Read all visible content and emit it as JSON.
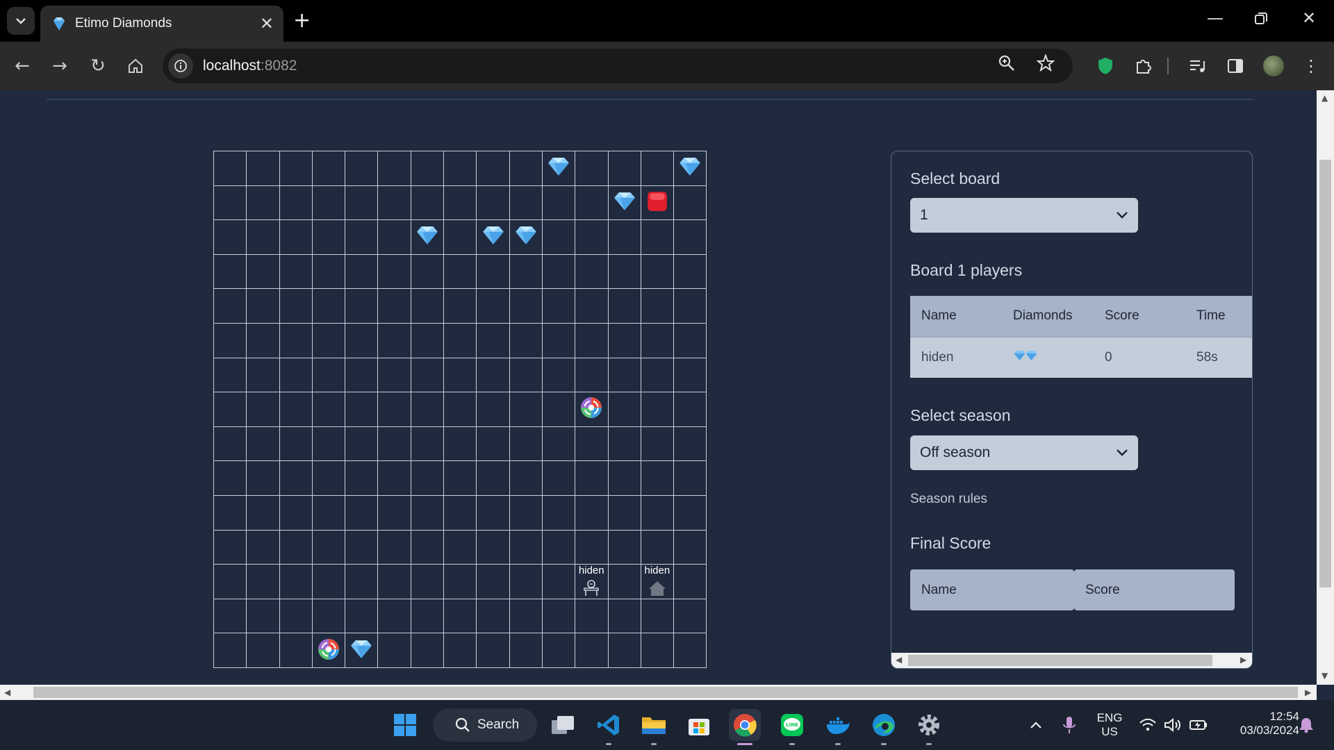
{
  "browser": {
    "tab_title": "Etimo Diamonds",
    "url_host": "localhost",
    "url_port": ":8082"
  },
  "board": {
    "rows": 15,
    "cols": 15,
    "objects": [
      {
        "type": "diamond",
        "row": 0,
        "col": 10
      },
      {
        "type": "diamond",
        "row": 0,
        "col": 14
      },
      {
        "type": "diamond",
        "row": 1,
        "col": 12
      },
      {
        "type": "red-button",
        "row": 1,
        "col": 13
      },
      {
        "type": "diamond",
        "row": 2,
        "col": 6
      },
      {
        "type": "diamond",
        "row": 2,
        "col": 8
      },
      {
        "type": "diamond",
        "row": 2,
        "col": 9
      },
      {
        "type": "teleporter",
        "row": 7,
        "col": 11
      },
      {
        "type": "bot",
        "row": 12,
        "col": 11,
        "label": "hiden"
      },
      {
        "type": "base",
        "row": 12,
        "col": 13,
        "label": "hiden"
      },
      {
        "type": "teleporter",
        "row": 14,
        "col": 3
      },
      {
        "type": "diamond",
        "row": 14,
        "col": 4
      }
    ]
  },
  "panel": {
    "select_board_heading": "Select board",
    "board_value": "1",
    "players_heading": "Board 1 players",
    "players_table": {
      "headers": [
        "Name",
        "Diamonds",
        "Score",
        "Time"
      ],
      "rows": [
        {
          "name": "hiden",
          "diamonds": 2,
          "score": "0",
          "time": "58s"
        }
      ]
    },
    "select_season_heading": "Select season",
    "season_value": "Off season",
    "season_rules": "Season rules",
    "final_score_heading": "Final Score",
    "final_table_headers": [
      "Name",
      "Score"
    ]
  },
  "taskbar": {
    "search_label": "Search",
    "lang_line1": "ENG",
    "lang_line2": "US",
    "time": "12:54",
    "date": "03/03/2024"
  },
  "colors": {
    "page_bg": "#1f2a3f",
    "grid_line": "#c9cfd8",
    "table_header": "#a7b3c7",
    "table_row": "#c4cdda"
  }
}
